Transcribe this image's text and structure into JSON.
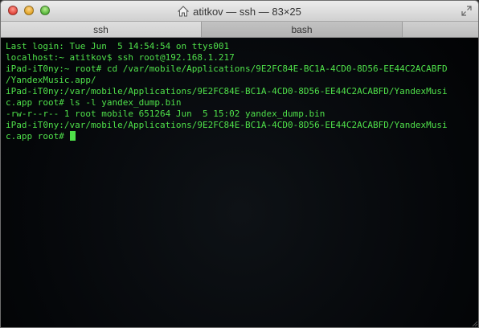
{
  "window": {
    "title": "atitkov — ssh — 83×25"
  },
  "tabs": [
    {
      "label": "ssh"
    },
    {
      "label": "bash"
    }
  ],
  "terminal": {
    "lines": [
      "Last login: Tue Jun  5 14:54:54 on ttys001",
      "localhost:~ atitkov$ ssh root@192.168.1.217",
      "iPad-iT0ny:~ root# cd /var/mobile/Applications/9E2FC84E-BC1A-4CD0-8D56-EE44C2ACABFD",
      "/YandexMusic.app/",
      "iPad-iT0ny:/var/mobile/Applications/9E2FC84E-BC1A-4CD0-8D56-EE44C2ACABFD/YandexMusi",
      "c.app root# ls -l yandex_dump.bin",
      "-rw-r--r-- 1 root mobile 651264 Jun  5 15:02 yandex_dump.bin",
      "iPad-iT0ny:/var/mobile/Applications/9E2FC84E-BC1A-4CD0-8D56-EE44C2ACABFD/YandexMusi",
      "c.app root# "
    ]
  }
}
